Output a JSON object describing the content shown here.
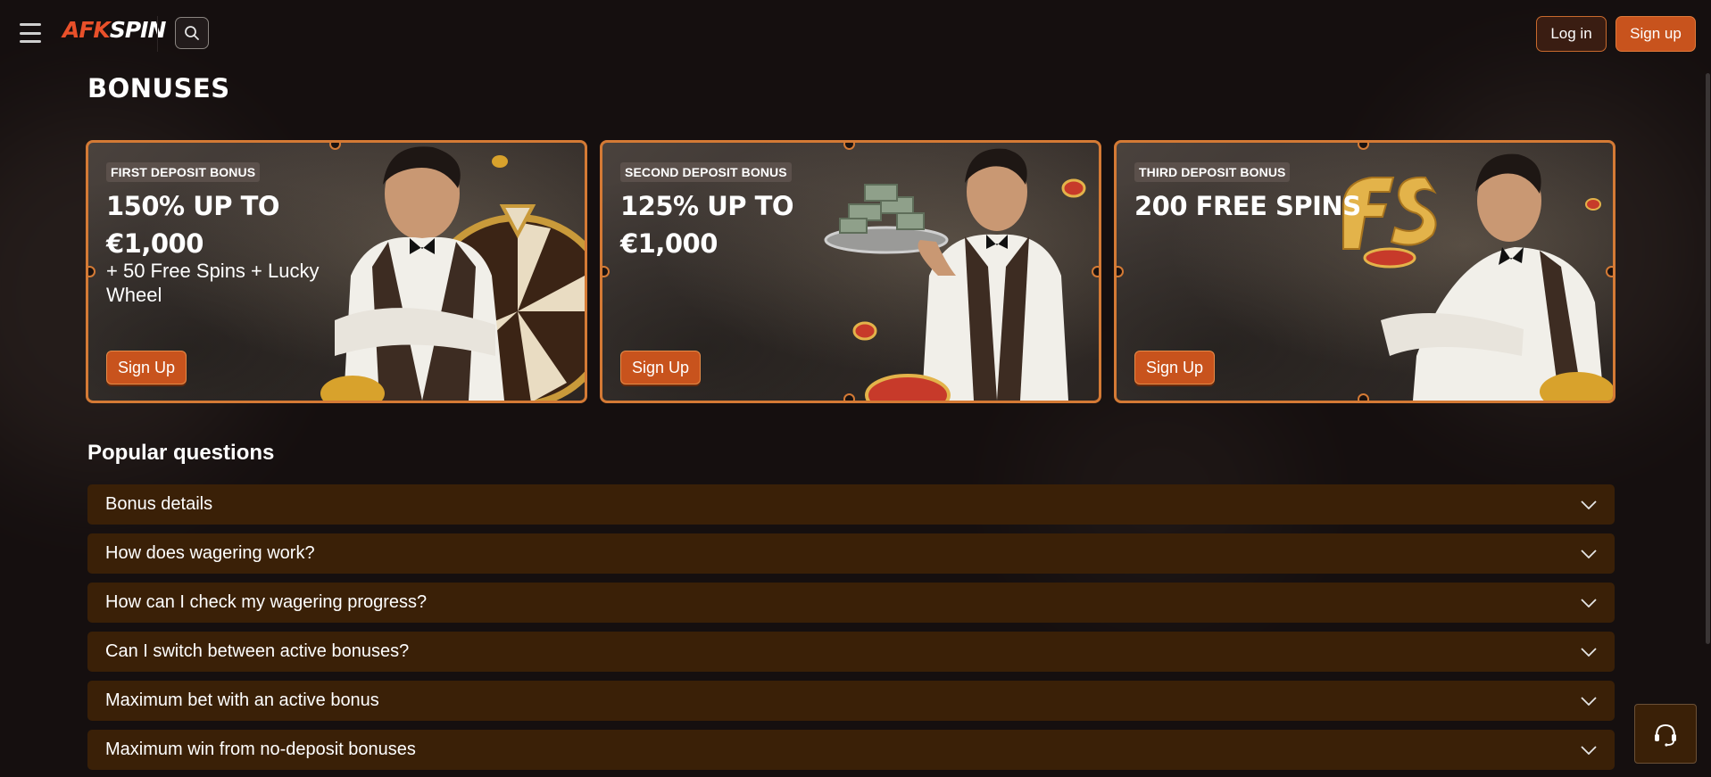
{
  "header": {
    "logo_part1": "AFK",
    "logo_part2": "SPIN",
    "login_label": "Log in",
    "signup_label": "Sign up"
  },
  "page": {
    "title": "BONUSES"
  },
  "bonuses": [
    {
      "badge": "FIRST DEPOSIT BONUS",
      "title": "150% UP TO €1,000",
      "subtitle": "+ 50 Free Spins + Lucky Wheel",
      "button": "Sign Up"
    },
    {
      "badge": "SECOND DEPOSIT BONUS",
      "title": "125% UP TO €1,000",
      "subtitle": "",
      "button": "Sign Up"
    },
    {
      "badge": "THIRD DEPOSIT BONUS",
      "title": "200 FREE SPINS",
      "subtitle": "",
      "button": "Sign Up"
    }
  ],
  "faq": {
    "title": "Popular questions",
    "items": [
      {
        "question": "Bonus details"
      },
      {
        "question": "How does wagering work?"
      },
      {
        "question": "How can I check my wagering progress?"
      },
      {
        "question": "Can I switch between active bonuses?"
      },
      {
        "question": "Maximum bet with an active bonus"
      },
      {
        "question": "Maximum win from no-deposit bonuses"
      }
    ]
  },
  "icons": {
    "menu": "menu-icon",
    "search": "search-icon",
    "chevron": "chevron-down-icon",
    "support": "headset-icon"
  },
  "colors": {
    "background": "#150f0f",
    "accent": "#c8531d",
    "card_border": "#d47a35",
    "faq_bg": "#3a2007"
  }
}
